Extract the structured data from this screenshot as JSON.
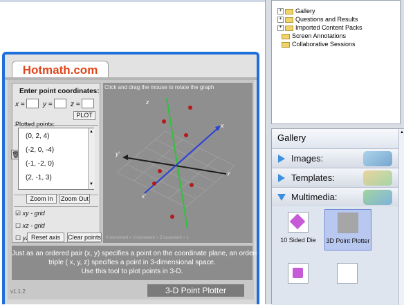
{
  "widget": {
    "brand": "Hotmath.com",
    "instruction": "Click and drag the mouse to rotate the graph",
    "enter_label": "Enter point coordinates:",
    "x_label": "x =",
    "y_label": "y =",
    "z_label": "z =",
    "plot_button": "PLOT",
    "plotted_label": "Plotted points:",
    "points": [
      "(0, 2, 4)",
      "(-2, 0, -4)",
      "(-1, -2, 0)",
      "(2, -1, 3)"
    ],
    "zoom_in": "Zoom In",
    "zoom_out": "Zoom Out",
    "grid_xy": "xy - grid",
    "grid_xz": "xz - grid",
    "grid_yz": "yz - grid",
    "grid_xy_mark": "☑",
    "grid_off_mark": "☐",
    "reset_axis": "Reset axis",
    "clear_points": "Clear points",
    "axis_z": "z",
    "axis_x": "x",
    "axis_y_neg": "y'",
    "axis_x_neg": "x'",
    "axis_y": "y",
    "increment_text": "X-increment = Y-increment = Z-increment = 1",
    "description": [
      "Just as an ordered pair (x, y) specifies a point on the coordinate plane, an ordered",
      "triple ( x, y, z) specifies a point in 3-dimensional space.",
      "Use this tool to plot points in 3-D."
    ],
    "version": "v1.1.2",
    "title": "3-D Point Plotter"
  },
  "tree": {
    "items": [
      {
        "label": "Gallery",
        "expandable": true
      },
      {
        "label": "Questions and Results",
        "expandable": true
      },
      {
        "label": "Imported Content Packs",
        "expandable": true
      },
      {
        "label": "Screen Annotations",
        "expandable": false
      },
      {
        "label": "Collaborative Sessions",
        "expandable": false
      }
    ]
  },
  "gallery": {
    "title": "Gallery",
    "sections": [
      "Images:",
      "Templates:",
      "Multimedia:"
    ],
    "items": [
      "10 Sided Die",
      "3D Point Plotter"
    ]
  },
  "colors": {
    "accent": "#1e6fd9",
    "brand": "#e0461c",
    "x_axis": "#2a3fd8",
    "y_axis": "#1e1e1e",
    "z_axis": "#2fc23a",
    "point": "#b51a1a"
  }
}
